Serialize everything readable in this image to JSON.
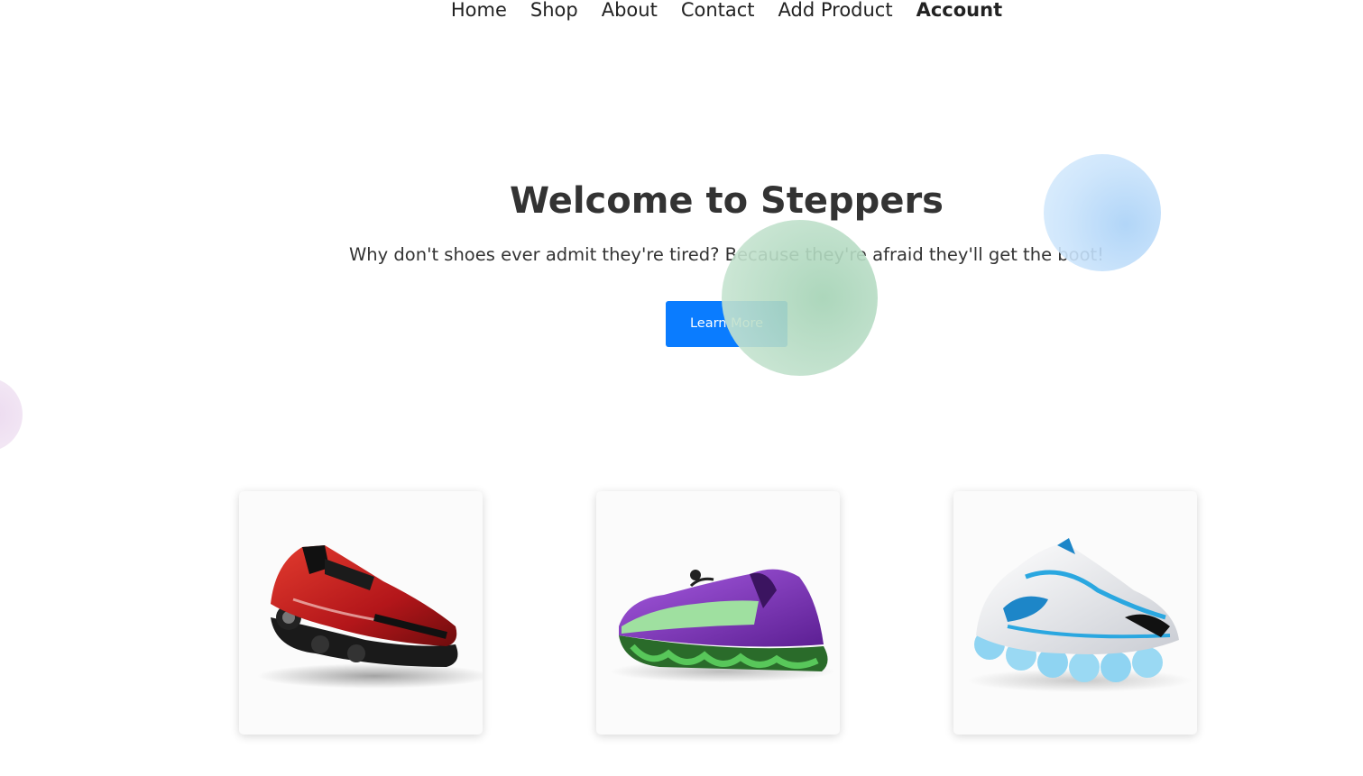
{
  "nav": {
    "items": [
      {
        "label": "Home"
      },
      {
        "label": "Shop"
      },
      {
        "label": "About"
      },
      {
        "label": "Contact"
      },
      {
        "label": "Add Product"
      },
      {
        "label": "Account"
      }
    ]
  },
  "hero": {
    "title": "Welcome to Steppers",
    "subtitle": "Why don't shoes ever admit they're tired? Because they're afraid they'll get the boot!",
    "button_label": "Learn More",
    "button_color": "#0a7cff"
  },
  "products": [
    {
      "image": "red-black-futuristic-sneaker",
      "color": "#c21f1f"
    },
    {
      "image": "purple-green-futuristic-sneaker",
      "color": "#7b2fbe"
    },
    {
      "image": "white-blue-futuristic-sneaker",
      "color": "#2aa7e0"
    }
  ],
  "colors": {
    "bubble_blue": "#c9e3fb",
    "bubble_green": "#b9ddc6",
    "bubble_purple": "#f2e6f4"
  }
}
